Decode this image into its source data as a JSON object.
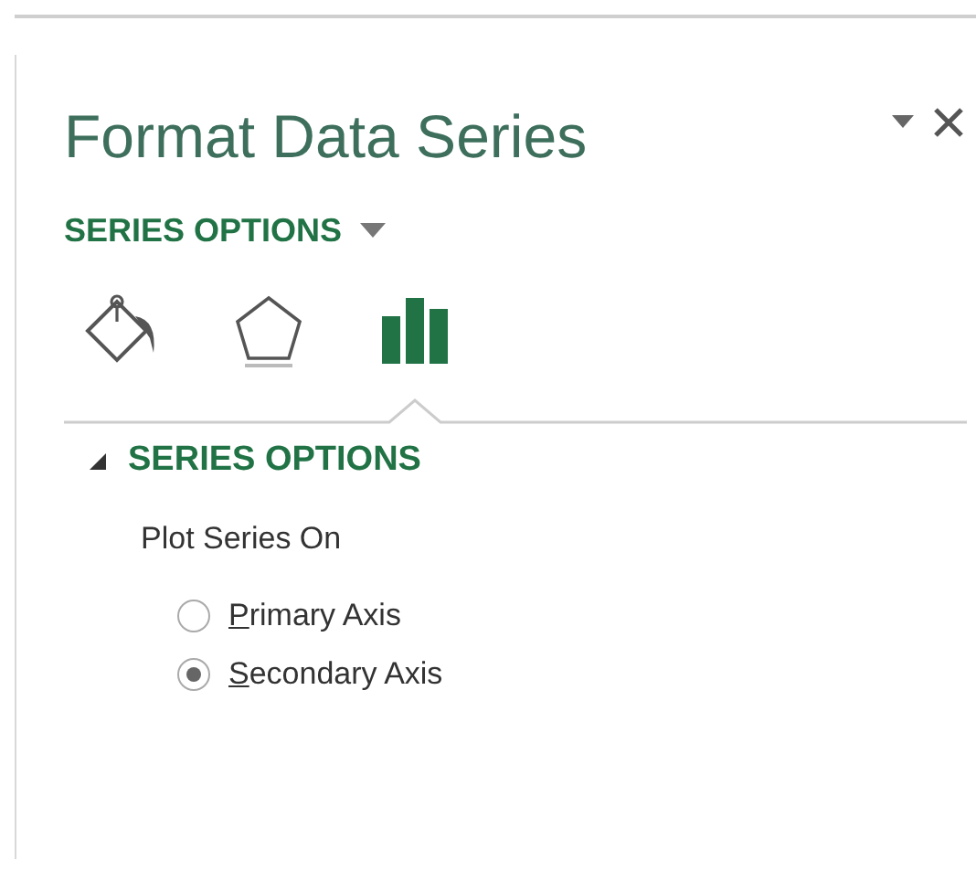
{
  "pane": {
    "title": "Format Data Series",
    "options_menu": "SERIES OPTIONS"
  },
  "tabs": [
    {
      "kind": "fill",
      "selected": false
    },
    {
      "kind": "effects",
      "selected": false
    },
    {
      "kind": "series",
      "selected": true
    }
  ],
  "section": {
    "title": "SERIES OPTIONS",
    "expanded": true,
    "label": "Plot Series On",
    "options": [
      {
        "label": "Primary Axis",
        "selected": false
      },
      {
        "label": "Secondary Axis",
        "selected": true
      }
    ]
  }
}
